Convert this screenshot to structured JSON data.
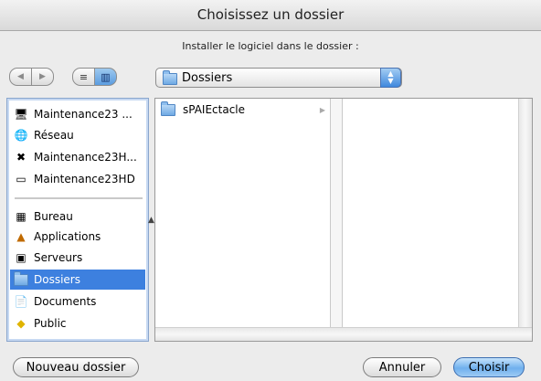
{
  "window": {
    "title": "Choisissez un dossier"
  },
  "prompt": "Installer le logiciel dans le dossier :",
  "toolbar": {
    "back_icon": "left-arrow",
    "forward_icon": "right-arrow",
    "list_view_icon": "list-view",
    "column_view_icon": "column-view",
    "selected_view": "column",
    "location_popup": "Dossiers"
  },
  "sidebar": {
    "devices": [
      {
        "label": "Maintenance23 ...",
        "icon": "computer-icon"
      },
      {
        "label": "Réseau",
        "icon": "network-icon"
      },
      {
        "label": "Maintenance23H...",
        "icon": "osx-disk-icon"
      },
      {
        "label": "Maintenance23HD",
        "icon": "hard-disk-icon"
      }
    ],
    "places": [
      {
        "label": "Bureau",
        "icon": "desktop-icon"
      },
      {
        "label": "Applications",
        "icon": "applications-icon"
      },
      {
        "label": "Serveurs",
        "icon": "servers-icon"
      },
      {
        "label": "Dossiers",
        "icon": "folder-icon",
        "selected": true
      },
      {
        "label": "Documents",
        "icon": "documents-icon"
      },
      {
        "label": "Public",
        "icon": "public-icon"
      }
    ]
  },
  "browser": {
    "column1": [
      {
        "label": "sPAIEctacle",
        "type": "folder",
        "has_children": true
      }
    ]
  },
  "buttons": {
    "new_folder": "Nouveau dossier",
    "cancel": "Annuler",
    "choose": "Choisir"
  },
  "colors": {
    "selection": "#3d80df",
    "default_button": "#6fb0ee"
  }
}
